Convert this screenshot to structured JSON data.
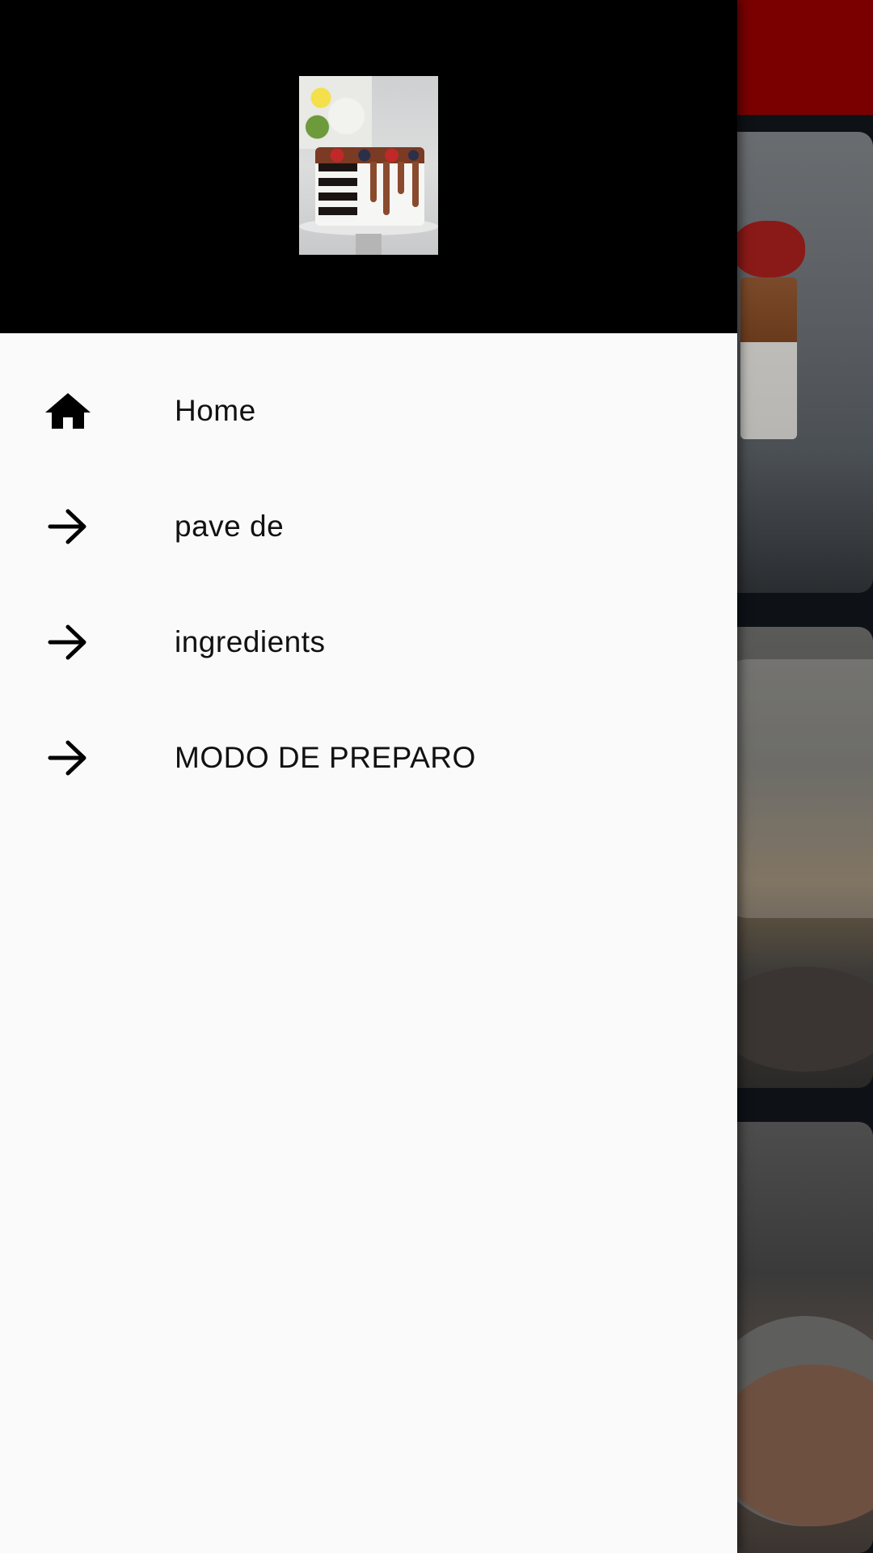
{
  "drawer": {
    "header": {
      "image": "layered-cake-photo"
    },
    "items": [
      {
        "label": "Home",
        "icon": "home-icon"
      },
      {
        "label": "pave de",
        "icon": "arrow-right-icon"
      },
      {
        "label": "ingredients",
        "icon": "arrow-right-icon"
      },
      {
        "label": "MODO DE PREPARO",
        "icon": "arrow-right-icon"
      }
    ]
  },
  "colors": {
    "drawer_background": "#fafafa",
    "header_background": "#000000",
    "toolbar": "#7a0000",
    "text": "#111111"
  }
}
